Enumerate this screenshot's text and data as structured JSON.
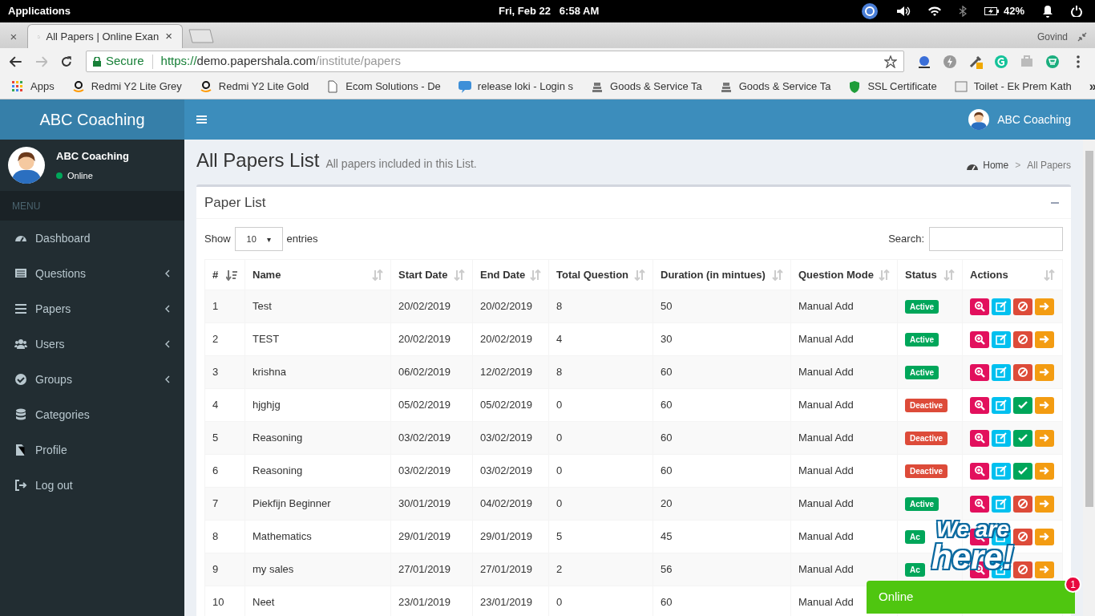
{
  "system_bar": {
    "menu": "Applications",
    "clock": "Fri, Feb 22   6:58 AM",
    "battery": "42%"
  },
  "browser": {
    "close_window": "×",
    "tab_close": "×",
    "more_bookmarks": "»",
    "tabs": [
      {
        "title": "All Papers | Online Exan",
        "selected": true
      }
    ],
    "profile": "Govind",
    "secure_label": "Secure",
    "url_scheme": "https://",
    "url_host": "demo.papershala.com",
    "url_path": "/institute/papers",
    "bookmarks": [
      "Apps",
      "Redmi Y2 Lite Grey",
      "Redmi Y2 Lite Gold",
      "Ecom Solutions - De",
      "release loki - Login s",
      "Goods & Service Ta",
      "Goods & Service Ta",
      "SSL Certificate",
      "Toilet - Ek Prem Kath"
    ]
  },
  "app": {
    "logo": "ABC Coaching",
    "header_user": "ABC Coaching",
    "sidebar_user": "ABC Coaching",
    "user_status": "Online",
    "menu_label": "MENU",
    "menu": [
      {
        "label": "Dashboard",
        "expandable": false
      },
      {
        "label": "Questions",
        "expandable": true
      },
      {
        "label": "Papers",
        "expandable": true
      },
      {
        "label": "Users",
        "expandable": true
      },
      {
        "label": "Groups",
        "expandable": true
      },
      {
        "label": "Categories",
        "expandable": false
      },
      {
        "label": "Profile",
        "expandable": false
      },
      {
        "label": "Log out",
        "expandable": false
      }
    ]
  },
  "page": {
    "title": "All Papers List",
    "subtitle": "All papers included in this List.",
    "breadcrumb": [
      "Home",
      "All Papers"
    ],
    "breadcrumb_separator": ">"
  },
  "box": {
    "title": "Paper List",
    "show_label": "Show",
    "page_size": "10",
    "select_arrow": "▾",
    "entries_label": "entries",
    "search_label": "Search:",
    "columns": [
      "#",
      "Name",
      "Start Date",
      "End Date",
      "Total Question",
      "Duration (in mintues)",
      "Question Mode",
      "Status",
      "Actions"
    ],
    "rows": [
      {
        "n": "1",
        "name": "Test",
        "start": "20/02/2019",
        "end": "20/02/2019",
        "total": "8",
        "duration": "50",
        "mode": "Manual Add",
        "status": "Active",
        "active": true
      },
      {
        "n": "2",
        "name": "TEST",
        "start": "20/02/2019",
        "end": "20/02/2019",
        "total": "4",
        "duration": "30",
        "mode": "Manual Add",
        "status": "Active",
        "active": true
      },
      {
        "n": "3",
        "name": "krishna",
        "start": "06/02/2019",
        "end": "12/02/2019",
        "total": "8",
        "duration": "60",
        "mode": "Manual Add",
        "status": "Active",
        "active": true
      },
      {
        "n": "4",
        "name": "hjghjg",
        "start": "05/02/2019",
        "end": "05/02/2019",
        "total": "0",
        "duration": "60",
        "mode": "Manual Add",
        "status": "Deactive",
        "active": false
      },
      {
        "n": "5",
        "name": "Reasoning",
        "start": "03/02/2019",
        "end": "03/02/2019",
        "total": "0",
        "duration": "60",
        "mode": "Manual Add",
        "status": "Deactive",
        "active": false
      },
      {
        "n": "6",
        "name": "Reasoning",
        "start": "03/02/2019",
        "end": "03/02/2019",
        "total": "0",
        "duration": "60",
        "mode": "Manual Add",
        "status": "Deactive",
        "active": false
      },
      {
        "n": "7",
        "name": "Piekfijn Beginner",
        "start": "30/01/2019",
        "end": "04/02/2019",
        "total": "0",
        "duration": "20",
        "mode": "Manual Add",
        "status": "Active",
        "active": true
      },
      {
        "n": "8",
        "name": "Mathematics",
        "start": "29/01/2019",
        "end": "29/01/2019",
        "total": "5",
        "duration": "45",
        "mode": "Manual Add",
        "status": "Ac",
        "active": true
      },
      {
        "n": "9",
        "name": "my sales",
        "start": "27/01/2019",
        "end": "27/01/2019",
        "total": "2",
        "duration": "56",
        "mode": "Manual Add",
        "status": "Ac",
        "active": true
      },
      {
        "n": "10",
        "name": "Neet",
        "start": "23/01/2019",
        "end": "23/01/2019",
        "total": "0",
        "duration": "60",
        "mode": "Manual Add"
      }
    ]
  },
  "chat_widget": {
    "tagline_1": "We are",
    "tagline_2": "here!",
    "label": "Online",
    "unread": "1"
  }
}
